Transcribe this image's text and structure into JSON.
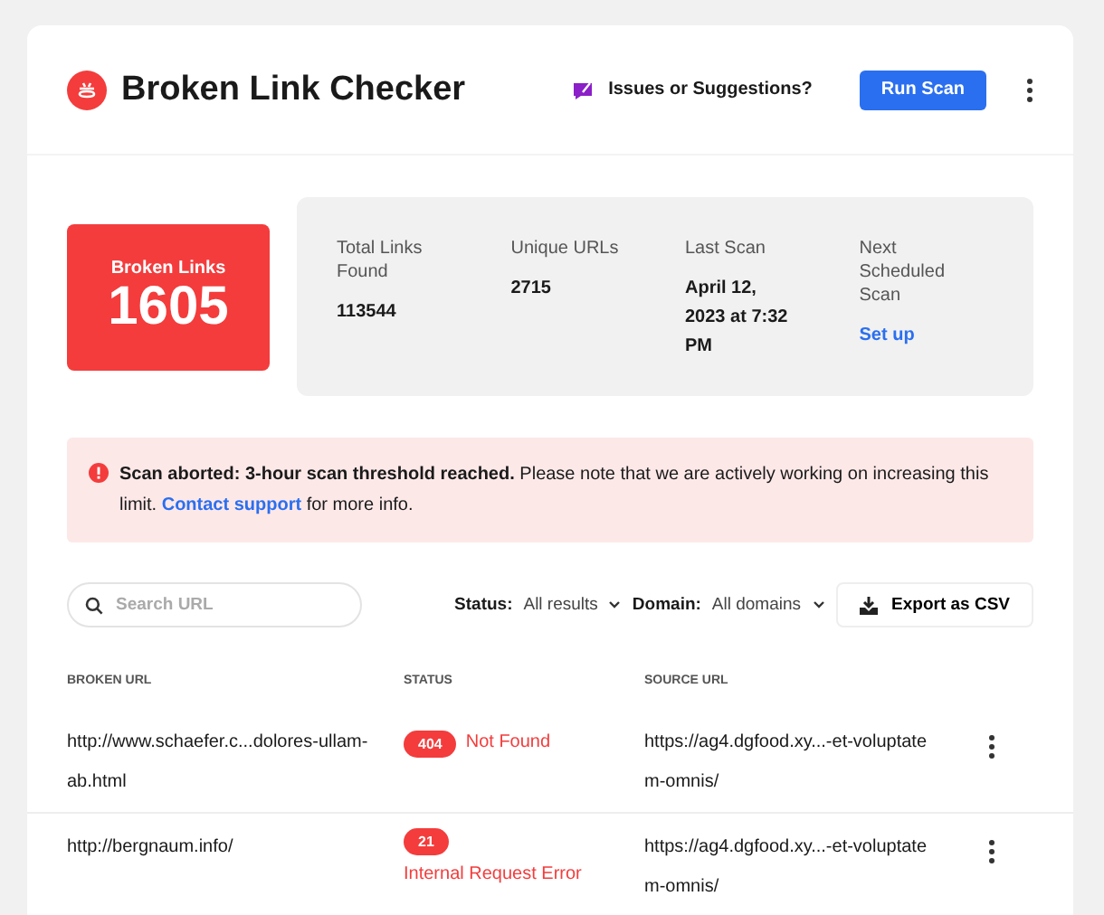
{
  "header": {
    "title": "Broken Link Checker",
    "feedback": "Issues or Suggestions?",
    "run_button": "Run Scan"
  },
  "summary": {
    "label": "Broken Links",
    "count": "1605",
    "stats": [
      {
        "label": "Total Links Found",
        "value": "113544",
        "kind": "value"
      },
      {
        "label": "Unique URLs",
        "value": "2715",
        "kind": "value"
      },
      {
        "label": "Last Scan",
        "value": "April 12, 2023 at 7:32 PM",
        "kind": "value"
      },
      {
        "label": "Next Scheduled Scan",
        "value": "Set up",
        "kind": "link"
      }
    ]
  },
  "alert": {
    "title": "Scan aborted: 3-hour scan threshold reached.",
    "text": "Please note that we are actively working on increasing this limit.",
    "link": "Contact support",
    "tail": "for more info."
  },
  "toolbar": {
    "search": {
      "placeholder": "Search URL"
    },
    "filters": [
      {
        "label": "Status:",
        "value": "All results"
      },
      {
        "label": "Domain:",
        "value": "All domains"
      }
    ],
    "export": "Export as CSV"
  },
  "table": {
    "columns": [
      "BROKEN URL",
      "STATUS",
      "SOURCE URL"
    ],
    "rows": [
      {
        "broken_url": "http://www.schaefer.c...dolores-ullam-ab.html",
        "code": "404",
        "status": "Not Found",
        "source_url": "https://ag4.dgfood.xy...-et-voluptatem-omnis/"
      },
      {
        "broken_url": "http://bergnaum.info/",
        "code": "21",
        "status": "Internal Request Error",
        "source_url": "https://ag4.dgfood.xy...-et-voluptatem-omnis/"
      }
    ]
  }
}
